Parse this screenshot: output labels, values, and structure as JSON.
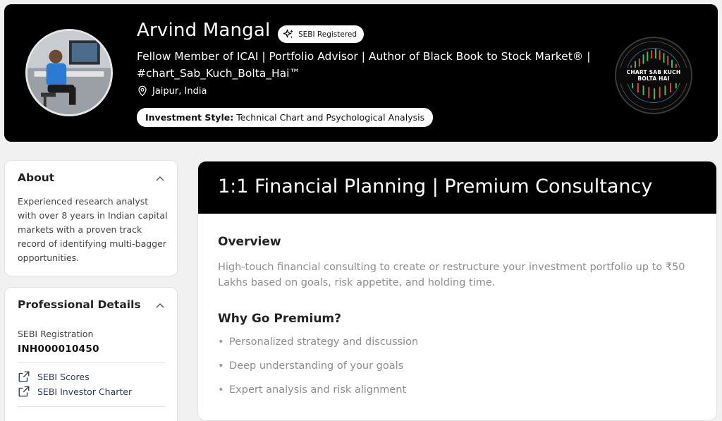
{
  "profile": {
    "name": "Arvind Mangal",
    "badge": "SEBI Registered",
    "headline": "Fellow Member of ICAI | Portfolio Advisor | Author of Black Book to Stock Market® | #chart_Sab_Kuch_Bolta_Hai™",
    "location": "Jaipur, India",
    "investment_style_label": "Investment Style:",
    "investment_style_value": "Technical Chart and Psychological Analysis",
    "logo_text": "CHART SAB KUCH BOLTA HAI"
  },
  "about": {
    "title": "About",
    "text": "Experienced research analyst with over 8 years in Indian capital markets with a proven track record of identifying multi-bagger opportunities."
  },
  "professional": {
    "title": "Professional Details",
    "reg_label": "SEBI Registration",
    "reg_value": "INH000010450",
    "links": [
      "SEBI Scores",
      "SEBI Investor Charter"
    ]
  },
  "service": {
    "title": "1:1 Financial Planning | Premium Consultancy",
    "overview_title": "Overview",
    "overview_text": "High-touch financial consulting to create or restructure your investment portfolio up to ₹50 Lakhs based on goals, risk appetite, and holding time.",
    "why_title": "Why Go Premium?",
    "bullets": [
      "Personalized strategy and discussion",
      "Deep understanding of your goals",
      "Expert analysis and risk alignment"
    ]
  },
  "colors": {
    "header_bg": "#000000",
    "muted_text": "#8d8d8d",
    "link": "#2e3a5f"
  }
}
